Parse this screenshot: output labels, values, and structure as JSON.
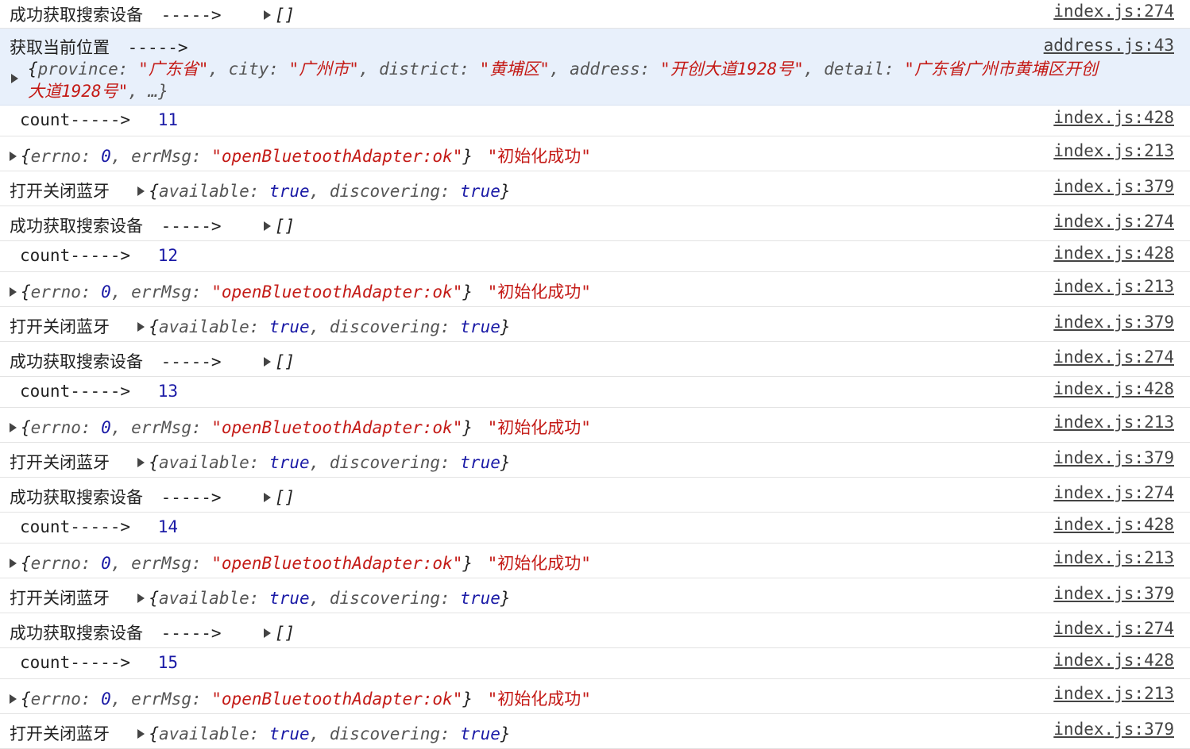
{
  "labels": {
    "search_success": "成功获取搜索设备",
    "arrow": "----->",
    "empty_array": "[]",
    "get_location": "获取当前位置",
    "count": "count----->",
    "toggle_bt": "打开关闭蓝牙",
    "init_success": "\"初始化成功\""
  },
  "location_object": {
    "line1": {
      "k_province": "province: ",
      "v_province": "\"广东省\"",
      "k_city": ", city: ",
      "v_city": "\"广州市\"",
      "k_district": ", district: ",
      "v_district": "\"黄埔区\"",
      "k_address": ", address: ",
      "v_address": "\"开创大道1928号\"",
      "k_detail": ", detail: ",
      "v_detail_a": "\"广东省广州市黄埔区开创"
    },
    "line2": {
      "v_detail_b": "大道1928号\"",
      "rest": ", …}"
    }
  },
  "bt_result": {
    "k_errno": "errno: ",
    "v_errno": "0",
    "k_errmsg": ", errMsg: ",
    "v_errmsg": "\"openBluetoothAdapter:ok\""
  },
  "bt_state": {
    "k_available": "available: ",
    "v_available": "true",
    "k_discovering": ", discovering: ",
    "v_discovering": "true"
  },
  "sources": {
    "s274": "index.js:274",
    "s43": "address.js:43",
    "s428": "index.js:428",
    "s213": "index.js:213",
    "s379": "index.js:379"
  },
  "counts": [
    "11",
    "12",
    "13",
    "14",
    "15"
  ]
}
